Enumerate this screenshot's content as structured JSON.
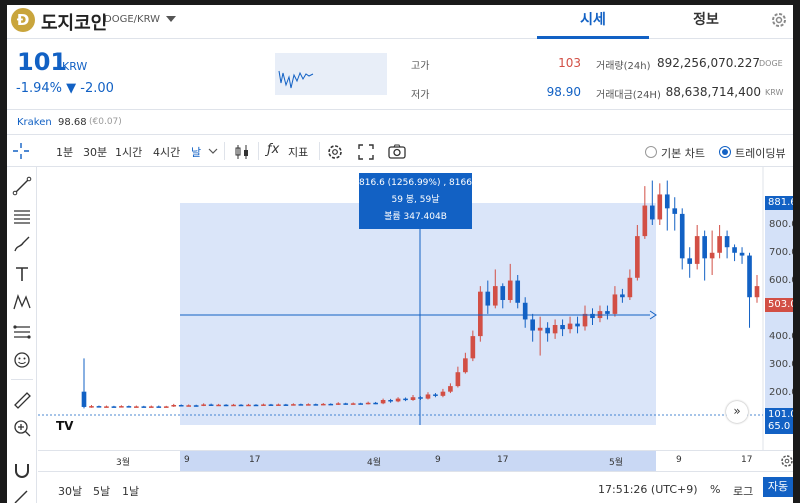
{
  "coin": {
    "logo_letter": "Ð",
    "name": "도지코인",
    "pair": "DOGE/KRW"
  },
  "tabs": [
    "시세",
    "정보"
  ],
  "price": {
    "value": "101",
    "unit": "KRW",
    "change": "-1.94% ▼ -2.00"
  },
  "stats": {
    "high_label": "고가",
    "high_value": "103",
    "low_label": "저가",
    "low_value": "98.90",
    "volume_label": "거래량(24h)",
    "volume_value": "892,256,070.227",
    "volume_unit": "DOGE",
    "amount_label": "거래대금(24H)",
    "amount_value": "88,638,714,400",
    "amount_unit": "KRW"
  },
  "exchange": {
    "name": "Kraken",
    "price": "98.68",
    "diff": "(€0.07)"
  },
  "toolbar": {
    "timeframes": [
      "1분",
      "30분",
      "1시간",
      "4시간",
      "날"
    ],
    "indicator_label": "지표",
    "basic_chart": "기본 차트",
    "trading_view": "트레이딩뷰"
  },
  "tooltip": {
    "line1": "816.6 (1256.99%) , 8166",
    "line2": "59 봉, 59날",
    "line3": "볼륨 347.404B"
  },
  "y_axis": [
    "800.0",
    "700.0",
    "600.0",
    "400.0",
    "300.0",
    "200.0",
    "100.0"
  ],
  "y_tags": {
    "top": "881.6",
    "mid": "503.0",
    "last": "101.0",
    "low": "65.0"
  },
  "x_axis": [
    "3월",
    "9",
    "17",
    "4월",
    "9",
    "17",
    "5월",
    "9",
    "17"
  ],
  "bottom": {
    "ranges": [
      "30날",
      "5날",
      "1날"
    ],
    "time": "17:51:26 (UTC+9)",
    "percent": "%",
    "log": "로그",
    "auto": "자동"
  },
  "colors": {
    "accent": "#1261c4",
    "up": "#d24f45",
    "down": "#1261c4",
    "selection": "#d4e1f8"
  },
  "chart_data": {
    "type": "candlestick",
    "y_range": [
      0,
      900
    ],
    "candles": [
      {
        "o": 120,
        "c": 65,
        "h": 240,
        "l": 60
      },
      {
        "o": 66,
        "c": 68,
        "h": 72,
        "l": 62
      },
      {
        "o": 68,
        "c": 66,
        "h": 70,
        "l": 63
      },
      {
        "o": 66,
        "c": 67,
        "h": 70,
        "l": 63
      },
      {
        "o": 67,
        "c": 66,
        "h": 69,
        "l": 63
      },
      {
        "o": 66,
        "c": 68,
        "h": 71,
        "l": 64
      },
      {
        "o": 68,
        "c": 66,
        "h": 70,
        "l": 64
      },
      {
        "o": 66,
        "c": 67,
        "h": 70,
        "l": 64
      },
      {
        "o": 67,
        "c": 66,
        "h": 69,
        "l": 63
      },
      {
        "o": 66,
        "c": 67,
        "h": 70,
        "l": 64
      },
      {
        "o": 67,
        "c": 66,
        "h": 70,
        "l": 63
      },
      {
        "o": 66,
        "c": 67,
        "h": 69,
        "l": 63
      },
      {
        "o": 67,
        "c": 72,
        "h": 76,
        "l": 65
      },
      {
        "o": 72,
        "c": 70,
        "h": 74,
        "l": 67
      },
      {
        "o": 70,
        "c": 71,
        "h": 74,
        "l": 67
      },
      {
        "o": 71,
        "c": 70,
        "h": 73,
        "l": 66
      },
      {
        "o": 70,
        "c": 74,
        "h": 78,
        "l": 68
      },
      {
        "o": 74,
        "c": 72,
        "h": 77,
        "l": 69
      },
      {
        "o": 72,
        "c": 73,
        "h": 76,
        "l": 69
      },
      {
        "o": 73,
        "c": 71,
        "h": 75,
        "l": 68
      },
      {
        "o": 71,
        "c": 73,
        "h": 76,
        "l": 69
      },
      {
        "o": 73,
        "c": 72,
        "h": 75,
        "l": 69
      },
      {
        "o": 72,
        "c": 73,
        "h": 76,
        "l": 69
      },
      {
        "o": 73,
        "c": 72,
        "h": 75,
        "l": 69
      },
      {
        "o": 72,
        "c": 74,
        "h": 77,
        "l": 70
      },
      {
        "o": 74,
        "c": 73,
        "h": 76,
        "l": 70
      },
      {
        "o": 73,
        "c": 74,
        "h": 77,
        "l": 70
      },
      {
        "o": 74,
        "c": 73,
        "h": 76,
        "l": 70
      },
      {
        "o": 73,
        "c": 75,
        "h": 78,
        "l": 70
      },
      {
        "o": 75,
        "c": 74,
        "h": 77,
        "l": 71
      },
      {
        "o": 74,
        "c": 75,
        "h": 78,
        "l": 71
      },
      {
        "o": 75,
        "c": 74,
        "h": 77,
        "l": 71
      },
      {
        "o": 74,
        "c": 76,
        "h": 79,
        "l": 71
      },
      {
        "o": 76,
        "c": 75,
        "h": 78,
        "l": 72
      },
      {
        "o": 75,
        "c": 78,
        "h": 82,
        "l": 72
      },
      {
        "o": 78,
        "c": 76,
        "h": 80,
        "l": 73
      },
      {
        "o": 76,
        "c": 78,
        "h": 81,
        "l": 73
      },
      {
        "o": 78,
        "c": 77,
        "h": 80,
        "l": 74
      },
      {
        "o": 77,
        "c": 80,
        "h": 84,
        "l": 74
      },
      {
        "o": 80,
        "c": 78,
        "h": 83,
        "l": 75
      },
      {
        "o": 78,
        "c": 90,
        "h": 95,
        "l": 75
      },
      {
        "o": 90,
        "c": 85,
        "h": 94,
        "l": 80
      },
      {
        "o": 85,
        "c": 95,
        "h": 100,
        "l": 82
      },
      {
        "o": 95,
        "c": 90,
        "h": 99,
        "l": 86
      },
      {
        "o": 90,
        "c": 100,
        "h": 108,
        "l": 87
      },
      {
        "o": 100,
        "c": 95,
        "h": 104,
        "l": 90
      },
      {
        "o": 95,
        "c": 110,
        "h": 118,
        "l": 92
      },
      {
        "o": 110,
        "c": 105,
        "h": 115,
        "l": 100
      },
      {
        "o": 105,
        "c": 120,
        "h": 130,
        "l": 100
      },
      {
        "o": 120,
        "c": 140,
        "h": 150,
        "l": 115
      },
      {
        "o": 140,
        "c": 190,
        "h": 210,
        "l": 135
      },
      {
        "o": 190,
        "c": 240,
        "h": 260,
        "l": 185
      },
      {
        "o": 240,
        "c": 320,
        "h": 340,
        "l": 230
      },
      {
        "o": 320,
        "c": 480,
        "h": 500,
        "l": 300
      },
      {
        "o": 480,
        "c": 430,
        "h": 520,
        "l": 400
      },
      {
        "o": 430,
        "c": 500,
        "h": 560,
        "l": 420
      },
      {
        "o": 500,
        "c": 450,
        "h": 510,
        "l": 420
      },
      {
        "o": 450,
        "c": 520,
        "h": 580,
        "l": 440
      },
      {
        "o": 520,
        "c": 440,
        "h": 540,
        "l": 420
      },
      {
        "o": 440,
        "c": 380,
        "h": 460,
        "l": 350
      },
      {
        "o": 380,
        "c": 340,
        "h": 400,
        "l": 300
      },
      {
        "o": 340,
        "c": 350,
        "h": 390,
        "l": 250
      },
      {
        "o": 350,
        "c": 330,
        "h": 370,
        "l": 300
      },
      {
        "o": 330,
        "c": 360,
        "h": 380,
        "l": 310
      },
      {
        "o": 360,
        "c": 345,
        "h": 380,
        "l": 320
      },
      {
        "o": 345,
        "c": 365,
        "h": 390,
        "l": 330
      },
      {
        "o": 365,
        "c": 355,
        "h": 390,
        "l": 330
      },
      {
        "o": 355,
        "c": 400,
        "h": 430,
        "l": 340
      },
      {
        "o": 400,
        "c": 385,
        "h": 420,
        "l": 360
      },
      {
        "o": 385,
        "c": 410,
        "h": 430,
        "l": 370
      },
      {
        "o": 410,
        "c": 400,
        "h": 430,
        "l": 380
      },
      {
        "o": 400,
        "c": 470,
        "h": 500,
        "l": 390
      },
      {
        "o": 470,
        "c": 460,
        "h": 490,
        "l": 440
      },
      {
        "o": 460,
        "c": 530,
        "h": 560,
        "l": 450
      },
      {
        "o": 530,
        "c": 680,
        "h": 720,
        "l": 520
      },
      {
        "o": 680,
        "c": 790,
        "h": 860,
        "l": 670
      },
      {
        "o": 790,
        "c": 740,
        "h": 880,
        "l": 720
      },
      {
        "o": 740,
        "c": 830,
        "h": 870,
        "l": 720
      },
      {
        "o": 830,
        "c": 780,
        "h": 880,
        "l": 700
      },
      {
        "o": 780,
        "c": 760,
        "h": 820,
        "l": 700
      },
      {
        "o": 760,
        "c": 600,
        "h": 780,
        "l": 560
      },
      {
        "o": 600,
        "c": 580,
        "h": 640,
        "l": 530
      },
      {
        "o": 580,
        "c": 680,
        "h": 720,
        "l": 560
      },
      {
        "o": 680,
        "c": 600,
        "h": 700,
        "l": 520
      },
      {
        "o": 600,
        "c": 620,
        "h": 700,
        "l": 540
      },
      {
        "o": 620,
        "c": 680,
        "h": 720,
        "l": 600
      },
      {
        "o": 680,
        "c": 640,
        "h": 700,
        "l": 600
      },
      {
        "o": 640,
        "c": 620,
        "h": 650,
        "l": 590
      },
      {
        "o": 620,
        "c": 610,
        "h": 640,
        "l": 580
      },
      {
        "o": 610,
        "c": 460,
        "h": 620,
        "l": 350
      },
      {
        "o": 460,
        "c": 500,
        "h": 540,
        "l": 440
      }
    ]
  }
}
